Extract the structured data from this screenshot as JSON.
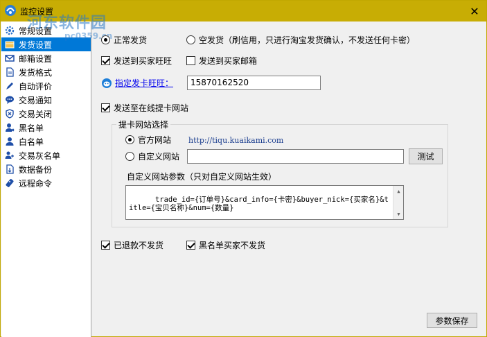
{
  "window": {
    "title": "监控设置",
    "close_glyph": "✕"
  },
  "watermark": {
    "text": "河东软件园",
    "url": "pc0359.cn"
  },
  "sidebar": {
    "items": [
      {
        "label": "常规设置",
        "icon": "gear-icon",
        "selected": false
      },
      {
        "label": "发货设置",
        "icon": "package-icon",
        "selected": true
      },
      {
        "label": "邮箱设置",
        "icon": "mail-icon",
        "selected": false
      },
      {
        "label": "发货格式",
        "icon": "document-icon",
        "selected": false
      },
      {
        "label": "自动评价",
        "icon": "pen-icon",
        "selected": false
      },
      {
        "label": "交易通知",
        "icon": "chat-icon",
        "selected": false
      },
      {
        "label": "交易关闭",
        "icon": "shield-icon",
        "selected": false
      },
      {
        "label": "黑名单",
        "icon": "user-block-icon",
        "selected": false
      },
      {
        "label": "白名单",
        "icon": "user-icon",
        "selected": false
      },
      {
        "label": "交易灰名单",
        "icon": "users-icon",
        "selected": false
      },
      {
        "label": "数据备份",
        "icon": "backup-icon",
        "selected": false
      },
      {
        "label": "远程命令",
        "icon": "remote-icon",
        "selected": false
      }
    ]
  },
  "delivery": {
    "normal_label": "正常发货",
    "normal_selected": true,
    "empty_label": "空发货（刷信用，只进行淘宝发货确认，不发送任何卡密）",
    "empty_selected": false
  },
  "send_wangwang": {
    "label": "发送到买家旺旺",
    "checked": true
  },
  "send_email": {
    "label": "发送到买家邮箱",
    "checked": false
  },
  "card_wangwang": {
    "link_label": "指定发卡旺旺：",
    "value": "15870162520"
  },
  "online_site": {
    "label": "发送至在线提卡网站",
    "checked": true
  },
  "site_group": {
    "title": "提卡网站选择",
    "official_label": "官方网站",
    "official_selected": true,
    "official_url": "http://tiqu.kuaikami.com",
    "custom_label": "自定义网站",
    "custom_selected": false,
    "custom_value": "",
    "test_button": "测试",
    "params_label": "自定义网站参数（只对自定义网站生效）",
    "params_value": "trade_id={订单号}&card_info={卡密}&buyer_nick={买家名}&title={宝贝名称}&num={数量}"
  },
  "refunded": {
    "label": "已退款不发货",
    "checked": true
  },
  "blacklist": {
    "label": "黑名单买家不发货",
    "checked": true
  },
  "save_button": "参数保存"
}
